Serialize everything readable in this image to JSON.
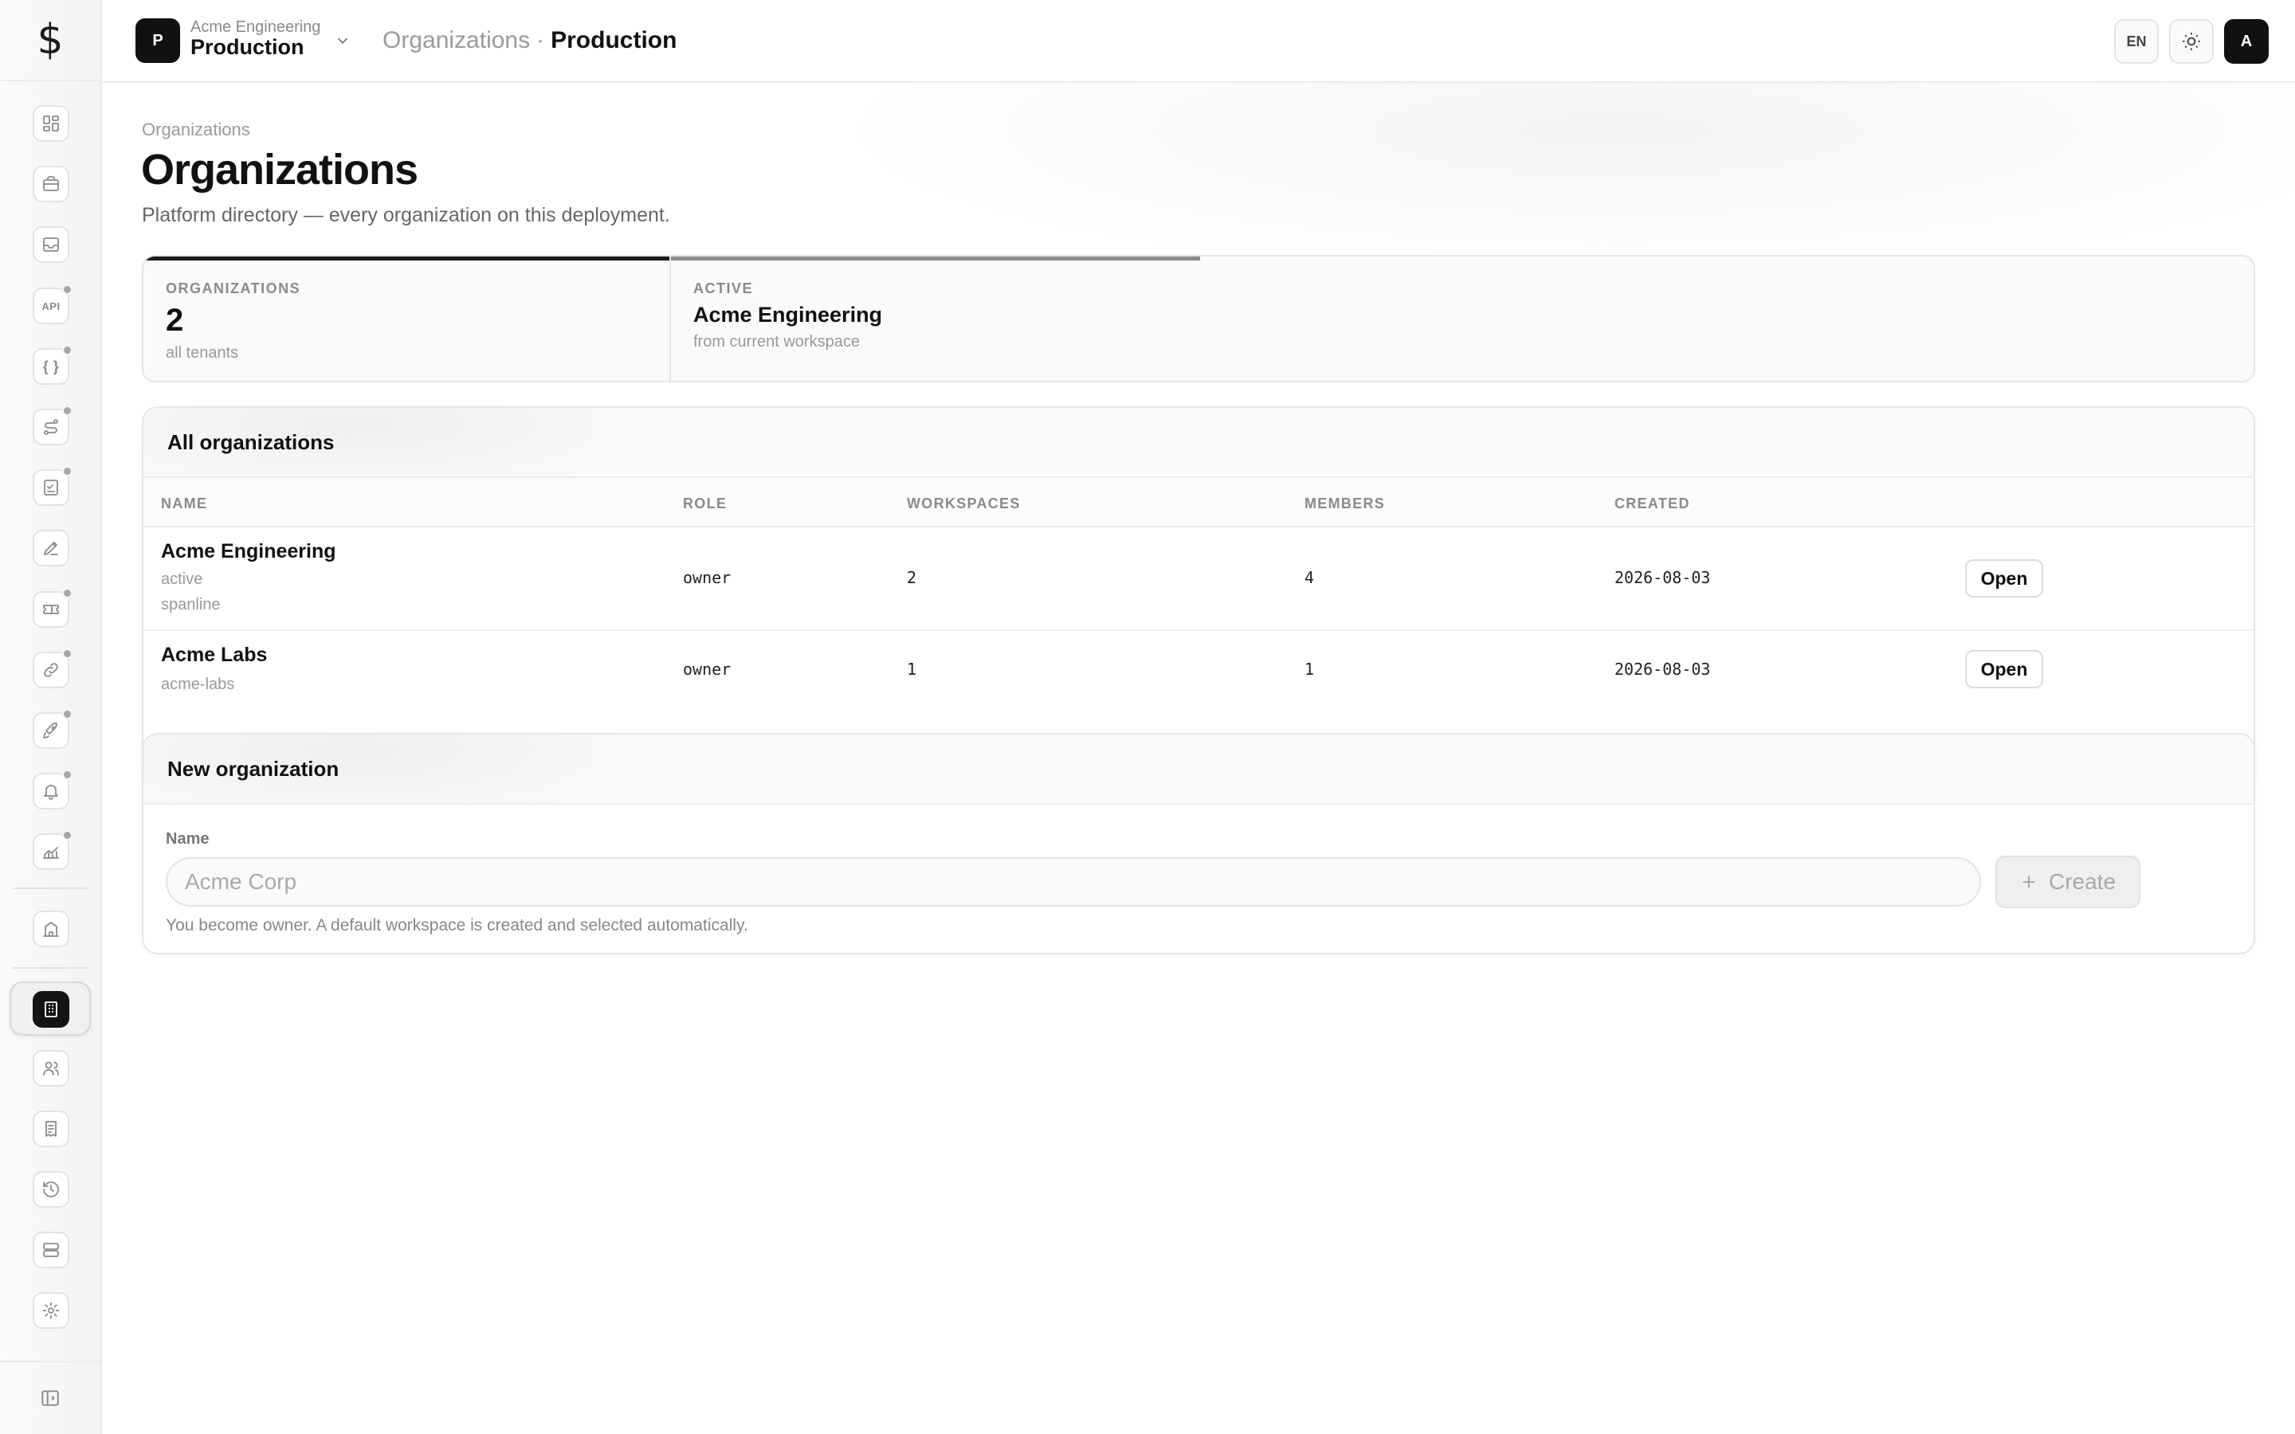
{
  "sidebar": {
    "logo_glyph": "$",
    "items": [
      {
        "icon": "dashboard-icon",
        "badge": false
      },
      {
        "icon": "briefcase-icon",
        "badge": false
      },
      {
        "icon": "inbox-icon",
        "badge": false
      },
      {
        "icon": "api-icon",
        "text": "API",
        "badge": true
      },
      {
        "icon": "braces-icon",
        "text": "{ }",
        "badge": true
      },
      {
        "icon": "route-icon",
        "badge": true
      },
      {
        "icon": "checklist-icon",
        "badge": true
      },
      {
        "icon": "pen-tool-icon",
        "badge": false
      },
      {
        "icon": "ticket-icon",
        "badge": true
      },
      {
        "icon": "link-icon",
        "badge": true
      },
      {
        "icon": "rocket-icon",
        "badge": true
      },
      {
        "icon": "bell-icon",
        "badge": true
      },
      {
        "icon": "chart-icon",
        "badge": true
      },
      {
        "icon": "building-icon",
        "badge": false
      },
      {
        "icon": "organization-icon",
        "badge": false,
        "active": true
      },
      {
        "icon": "users-icon",
        "badge": false
      },
      {
        "icon": "receipt-icon",
        "badge": false
      },
      {
        "icon": "history-icon",
        "badge": false
      },
      {
        "icon": "server-icon",
        "badge": false
      },
      {
        "icon": "gear-icon",
        "badge": false
      }
    ],
    "footer_icon": "sidebar-toggle-icon"
  },
  "header": {
    "workspace_initial": "P",
    "org_name": "Acme Engineering",
    "workspace_name": "Production",
    "breadcrumb_parent": "Organizations",
    "breadcrumb_sep": "·",
    "breadcrumb_current": "Production",
    "language": "EN",
    "avatar_initial": "A"
  },
  "page": {
    "breadcrumb": "Organizations",
    "title": "Organizations",
    "subtitle": "Platform directory — every organization on this deployment."
  },
  "stats": [
    {
      "label": "ORGANIZATIONS",
      "value": "2",
      "hint": "all tenants"
    },
    {
      "label": "ACTIVE",
      "value": "Acme Engineering",
      "hint": "from current workspace"
    }
  ],
  "orgs_table": {
    "title": "All organizations",
    "columns": [
      "NAME",
      "ROLE",
      "WORKSPACES",
      "MEMBERS",
      "CREATED"
    ],
    "rows": [
      {
        "name": "Acme Engineering",
        "status": "active",
        "slug": "spanline",
        "role": "owner",
        "workspaces": "2",
        "members": "4",
        "created": "2026-08-03",
        "action": "Open"
      },
      {
        "name": "Acme Labs",
        "slug": "acme-labs",
        "role": "owner",
        "workspaces": "1",
        "members": "1",
        "created": "2026-08-03",
        "action": "Open"
      }
    ]
  },
  "new_org": {
    "title": "New organization",
    "field_label": "Name",
    "placeholder": "Acme Corp",
    "value": "",
    "create_label": "Create",
    "hint": "You become owner. A default workspace is created and selected automatically."
  },
  "colors": {
    "accent": "#111111",
    "badge_dot": "#a8a8a8",
    "stat_bar_primary": "#1a1a1a",
    "stat_bar_secondary": "#8c8c8c"
  }
}
